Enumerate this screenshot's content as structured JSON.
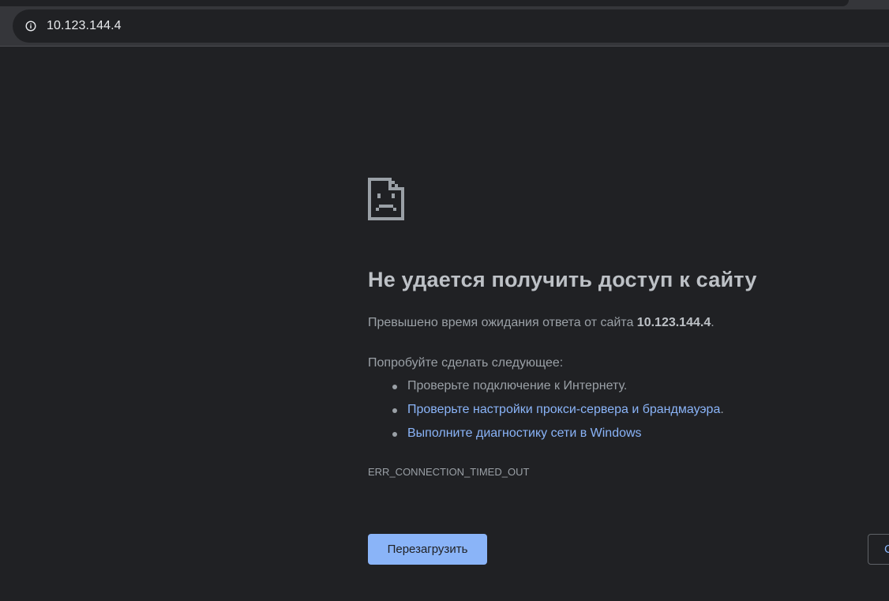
{
  "address_bar": {
    "url": "10.123.144.4",
    "info_icon": "info-icon"
  },
  "error_page": {
    "icon": "sad-page-icon",
    "title": "Не удается получить доступ к сайту",
    "description_prefix": "Превышено время ожидания ответа от сайта ",
    "description_host": "10.123.144.4",
    "description_suffix": ".",
    "try_heading": "Попробуйте сделать следующее:",
    "suggestions": [
      {
        "text": "Проверьте подключение к Интернету.",
        "link": false
      },
      {
        "text": "Проверьте настройки прокси-сервера и брандмауэра",
        "link": true,
        "suffix": "."
      },
      {
        "text": "Выполните диагностику сети в Windows",
        "link": true,
        "suffix": ""
      }
    ],
    "error_code": "ERR_CONNECTION_TIMED_OUT",
    "reload_label": "Перезагрузить",
    "details_label": "С"
  },
  "colors": {
    "background": "#202124",
    "toolbar": "#35363a",
    "link": "#8ab4f8",
    "text": "#9aa0a6",
    "title": "#bdc1c6"
  }
}
